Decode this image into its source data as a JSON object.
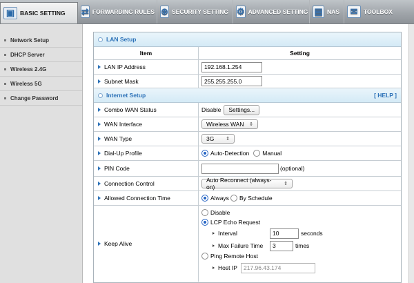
{
  "tabs": [
    {
      "label": "BASIC SETTING",
      "icon": "basic-setting-icon",
      "active": true
    },
    {
      "label": "FORWARDING RULES",
      "icon": "forwarding-rules-icon",
      "active": false
    },
    {
      "label": "SECURITY SETTING",
      "icon": "security-setting-icon",
      "active": false
    },
    {
      "label": "ADVANCED SETTING",
      "icon": "advanced-setting-icon",
      "active": false
    },
    {
      "label": "NAS",
      "icon": "nas-icon",
      "active": false
    },
    {
      "label": "TOOLBOX",
      "icon": "toolbox-icon",
      "active": false
    }
  ],
  "sidebar": {
    "items": [
      {
        "label": "Network Setup"
      },
      {
        "label": "DHCP Server"
      },
      {
        "label": "Wireless 2.4G"
      },
      {
        "label": "Wireless 5G"
      },
      {
        "label": "Change Password"
      }
    ]
  },
  "lan": {
    "title": "LAN Setup",
    "col_item": "Item",
    "col_setting": "Setting",
    "ip_label": "LAN IP Address",
    "ip_value": "192.168.1.254",
    "mask_label": "Subnet Mask",
    "mask_value": "255.255.255.0"
  },
  "internet": {
    "title": "Internet Setup",
    "help": "[ HELP ]",
    "combo_label": "Combo WAN Status",
    "combo_value": "Disable",
    "combo_button": "Settings...",
    "wan_if_label": "WAN Interface",
    "wan_if_value": "Wireless WAN",
    "wan_type_label": "WAN Type",
    "wan_type_value": "3G",
    "dialup_label": "Dial-Up Profile",
    "dialup_opt1": "Auto-Detection",
    "dialup_opt2": "Manual",
    "pin_label": "PIN Code",
    "pin_value": "",
    "pin_hint": "(optional)",
    "conn_label": "Connection Control",
    "conn_value": "Auto Reconnect (always-on)",
    "allowed_label": "Allowed Connection Time",
    "allowed_opt1": "Always",
    "allowed_opt2": "By Schedule",
    "keepalive_label": "Keep Alive",
    "ka_disable": "Disable",
    "ka_lcp": "LCP Echo Request",
    "ka_interval_label": "Interval",
    "ka_interval_value": "10",
    "ka_interval_unit": "seconds",
    "ka_maxfail_label": "Max Failure Time",
    "ka_maxfail_value": "3",
    "ka_maxfail_unit": "times",
    "ka_ping": "Ping Remote Host",
    "ka_hostip_label": "Host IP",
    "ka_hostip_value": "217.96.43.174"
  }
}
